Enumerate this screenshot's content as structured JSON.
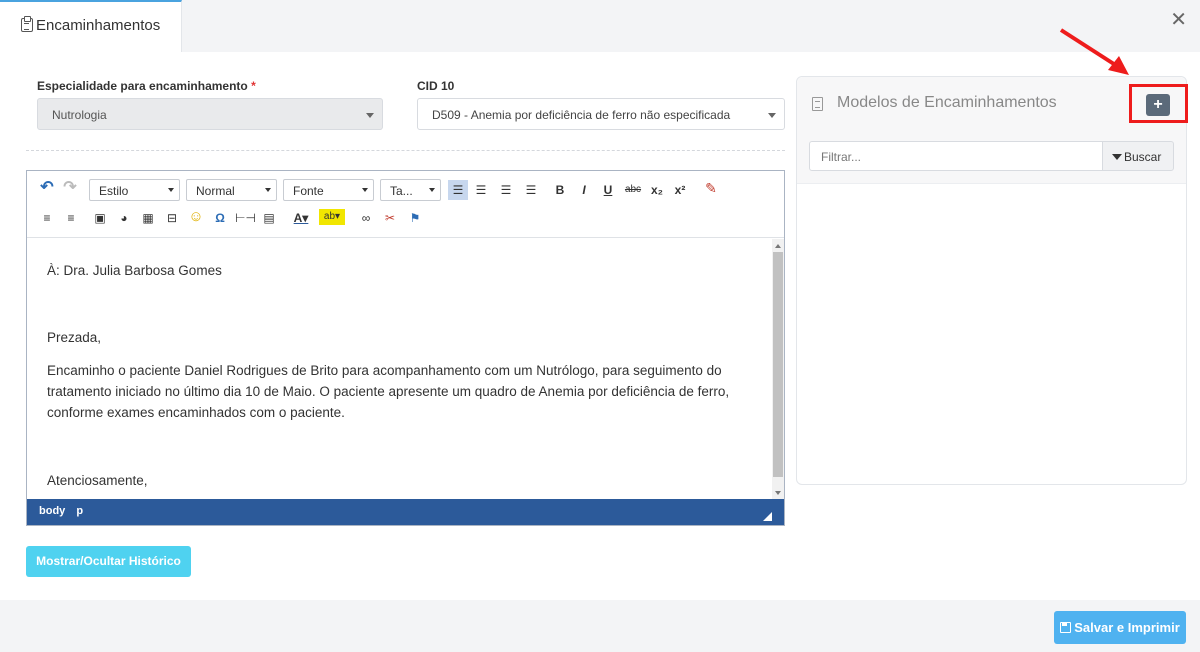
{
  "tab": {
    "label": "Encaminhamentos"
  },
  "form": {
    "specialty": {
      "label": "Especialidade para encaminhamento",
      "required_mark": "*",
      "value": "Nutrologia"
    },
    "cid": {
      "label": "CID 10",
      "value": "D509 - Anemia por deficiência de ferro não especificada"
    }
  },
  "editor": {
    "style_combo": "Estilo",
    "format_combo": "Normal",
    "font_combo": "Fonte",
    "size_combo": "Ta...",
    "paragraphs": [
      "À: Dra. Julia Barbosa Gomes",
      "Prezada,",
      "Encaminho o paciente Daniel Rodrigues de Brito para acompanhamento com um Nutrólogo, para seguimento do tratamento iniciado no último dia 10 de Maio. O paciente apresente um quadro de Anemia por deficiência de ferro, conforme exames encaminhados com o paciente.",
      "Atenciosamente,"
    ],
    "path": [
      "body",
      "p"
    ]
  },
  "buttons": {
    "history": "Mostrar/Ocultar Histórico",
    "save": "Salvar e Imprimir",
    "add": "+"
  },
  "panel": {
    "title": "Modelos de Encaminhamentos",
    "filter_placeholder": "Filtrar...",
    "search_label": "Buscar"
  },
  "colors": {
    "accent": "#4fb2f0",
    "editor_path_bar": "#2c5a9a",
    "annotation": "#ee1c1c"
  },
  "icons": {
    "close": "close-icon",
    "undo": "undo-icon",
    "redo": "redo-icon",
    "bold": "bold-icon",
    "italic": "italic-icon",
    "underline": "underline-icon"
  }
}
